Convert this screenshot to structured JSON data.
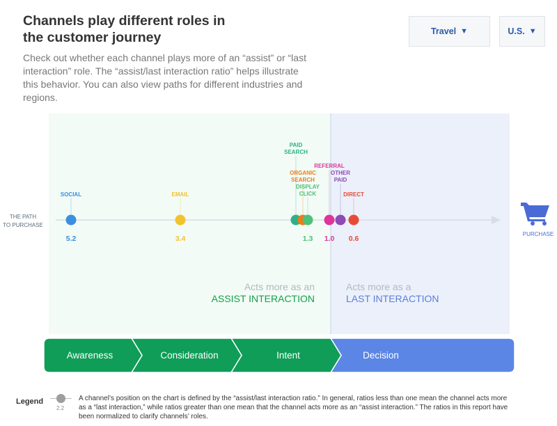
{
  "title_line1": "Channels play different roles in",
  "title_line2": "the customer journey",
  "description": "Check out whether each channel plays more of an “assist” or “last interaction” role. The “assist/last interaction ratio” helps illustrate this behavior. You can also view paths for different industries and regions.",
  "filters": {
    "industry": "Travel",
    "region": "U.S.",
    "caret": "▼"
  },
  "chart_data": {
    "type": "scatter",
    "axis_label_left": [
      "THE PATH",
      "TO PURCHASE"
    ],
    "axis_label_right": "PURCHASE",
    "points": [
      {
        "label": [
          "SOCIAL"
        ],
        "value": 5.2,
        "color": "#3b8fe0",
        "value_label": "5.2"
      },
      {
        "label": [
          "EMAIL"
        ],
        "value": 3.4,
        "color": "#f2c230",
        "value_label": "3.4"
      },
      {
        "label": [
          "PAID",
          "SEARCH"
        ],
        "value": 1.6,
        "color": "#2fb088",
        "value_label": ""
      },
      {
        "label": [
          "ORGANIC",
          "SEARCH"
        ],
        "value": 1.45,
        "color": "#f07b14",
        "value_label": ""
      },
      {
        "label": [
          "DISPLAY",
          "CLICK"
        ],
        "value": 1.3,
        "color": "#4fc079",
        "value_label": "1.3"
      },
      {
        "label": [
          "REFERRAL"
        ],
        "value": 1.0,
        "color": "#e0349a",
        "value_label": "1.0"
      },
      {
        "label": [
          "OTHER",
          "PAID"
        ],
        "value": 0.8,
        "color": "#8e4ab5",
        "value_label": ""
      },
      {
        "label": [
          "DIRECT"
        ],
        "value": 0.6,
        "color": "#e84b34",
        "value_label": "0.6"
      }
    ],
    "assist_region": {
      "line1": "Acts more as an",
      "line2": "ASSIST INTERACTION",
      "color": "#15a04a"
    },
    "last_region": {
      "line1": "Acts more as a",
      "line2": "LAST INTERACTION",
      "color": "#5b7fd6"
    }
  },
  "stages": [
    {
      "label": "Awareness",
      "color": "#0f9d58"
    },
    {
      "label": "Consideration",
      "color": "#0f9d58"
    },
    {
      "label": "Intent",
      "color": "#0f9d58"
    },
    {
      "label": "Decision",
      "color": "#5b86e5"
    }
  ],
  "legend": {
    "label": "Legend",
    "sample_value": "2.2",
    "text": "A channel’s position on the chart is defined by the “assist/last interaction ratio.” In general, ratios less than one mean the channel acts more as a “last interaction,” while ratios greater than one mean that the channel acts more as an “assist interaction.” The ratios in this report have been normalized to clarify channels’ roles."
  }
}
